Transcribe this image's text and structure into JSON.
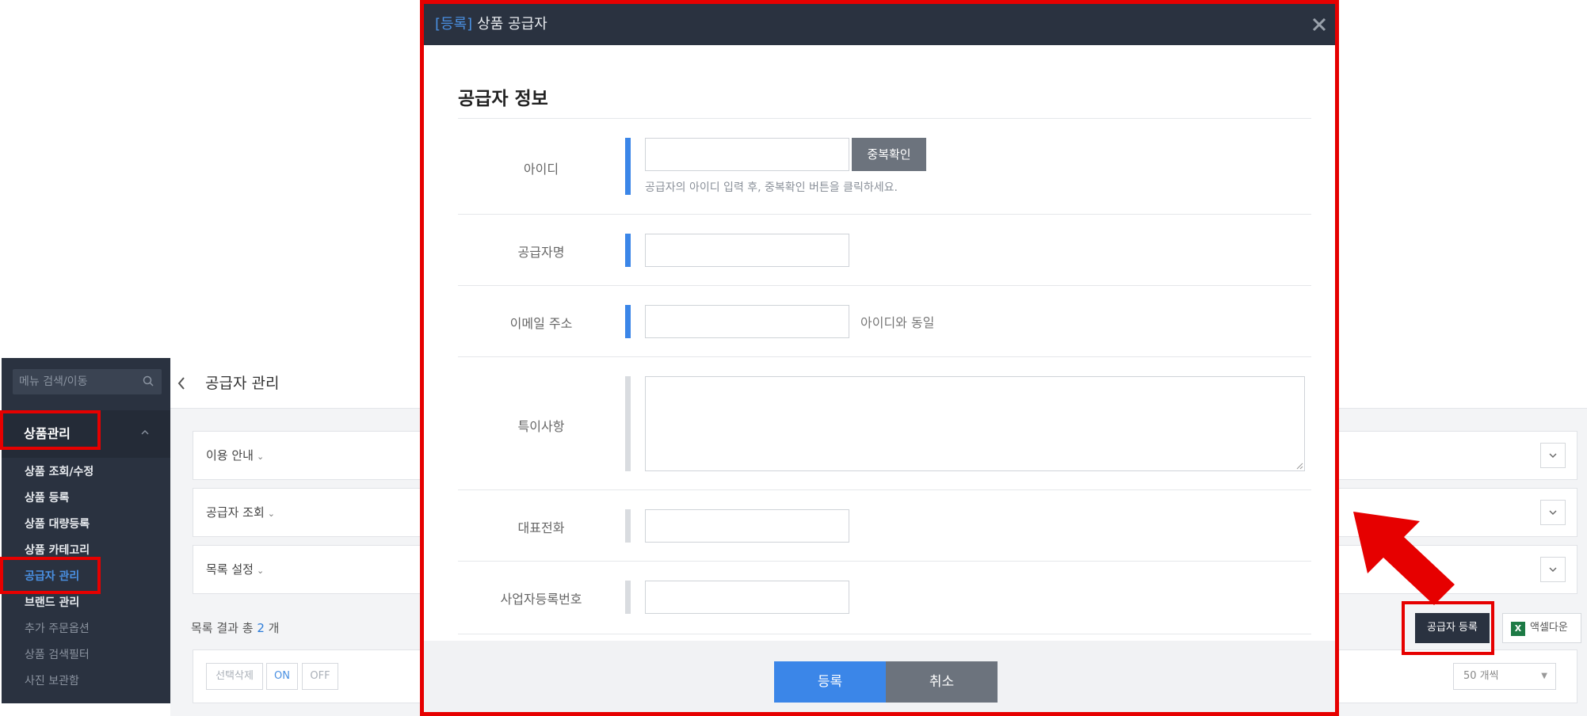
{
  "sidebar": {
    "search_placeholder": "메뉴 검색/이동",
    "section_label": "상품관리",
    "items": [
      {
        "label": "상품 조회/수정",
        "state": "normal"
      },
      {
        "label": "상품 등록",
        "state": "normal"
      },
      {
        "label": "상품 대량등록",
        "state": "normal"
      },
      {
        "label": "상품 카테고리",
        "state": "normal"
      },
      {
        "label": "공급자 관리",
        "state": "active"
      },
      {
        "label": "브랜드 관리",
        "state": "normal"
      },
      {
        "label": "추가 주문옵션",
        "state": "dim"
      },
      {
        "label": "상품 검색필터",
        "state": "dim"
      },
      {
        "label": "사진 보관함",
        "state": "dim"
      }
    ]
  },
  "main": {
    "page_title": "공급자 관리",
    "panels": {
      "guide": "이용 안내",
      "search": "공급자 조회",
      "list_settings": "목록 설정"
    },
    "result": {
      "prefix": "목록 결과 총",
      "count": "2",
      "suffix": "개"
    },
    "register_supplier_label": "공급자 등록",
    "excel_download_label": "액셀다운",
    "excel_icon_text": "X",
    "list_buttons": {
      "delete_selected": "선택삭제",
      "on": "ON",
      "off": "OFF"
    },
    "per_page": "50 개씩"
  },
  "modal": {
    "title_tag": "[등록]",
    "title": "상품 공급자",
    "section_title": "공급자 정보",
    "fields": {
      "id": {
        "label": "아이디",
        "value": "",
        "dup_check_label": "중복확인",
        "helper": "공급자의 아이디 입력 후, 중복확인 버튼을 클릭하세요."
      },
      "name": {
        "label": "공급자명",
        "value": ""
      },
      "email": {
        "label": "이메일 주소",
        "value": "",
        "note": "아이디와 동일"
      },
      "remarks": {
        "label": "특이사항",
        "value": ""
      },
      "phone": {
        "label": "대표전화",
        "value": ""
      },
      "biz_no": {
        "label": "사업자등록번호",
        "value": ""
      }
    },
    "submit_label": "등록",
    "cancel_label": "취소"
  },
  "colors": {
    "accent": "#3b86e8",
    "header_dark": "#2a3240",
    "highlight": "#e60000"
  }
}
